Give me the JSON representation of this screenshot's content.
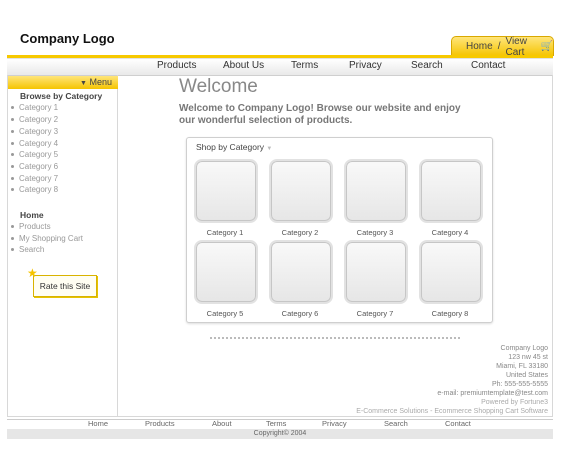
{
  "header": {
    "logo": "Company Logo",
    "home_link": "Home",
    "divider": "/",
    "cart_link": "View Cart"
  },
  "nav": [
    "Products",
    "About Us",
    "Terms",
    "Privacy",
    "Search",
    "Contact"
  ],
  "sidebar": {
    "menu_label": "Menu",
    "browse_heading": "Browse by Category",
    "categories": [
      "Category 1",
      "Category 2",
      "Category 3",
      "Category 4",
      "Category 5",
      "Category 6",
      "Category 7",
      "Category 8"
    ],
    "home_heading": "Home",
    "links": [
      "Products",
      "My Shopping Cart",
      "Search"
    ],
    "rate_button": "Rate this Site"
  },
  "main": {
    "title": "Welcome",
    "intro": "Welcome to  Company Logo! Browse our website and enjoy our wonderful selection of products.",
    "shop_title": "Shop by Category",
    "categories": [
      "Category 1",
      "Category 2",
      "Category 3",
      "Category 4",
      "Category 5",
      "Category 6",
      "Category 7",
      "Category 8"
    ]
  },
  "address": [
    "Company Logo",
    "123 nw 45 st",
    "Miami, FL 33180",
    "United States",
    "Ph: 555-555-5555",
    "e-mail: premiumtemplate@test.com",
    "Powered by Fortune3",
    "E-Commerce Solutions - Ecommerce Shopping Cart Software"
  ],
  "footer": {
    "links": [
      "Home",
      "Products",
      "About",
      "Terms",
      "Privacy",
      "Search",
      "Contact"
    ],
    "copyright": "Copyright© 2004"
  },
  "colors": {
    "accent": "#f5c400",
    "border": "#d8d8d8"
  }
}
